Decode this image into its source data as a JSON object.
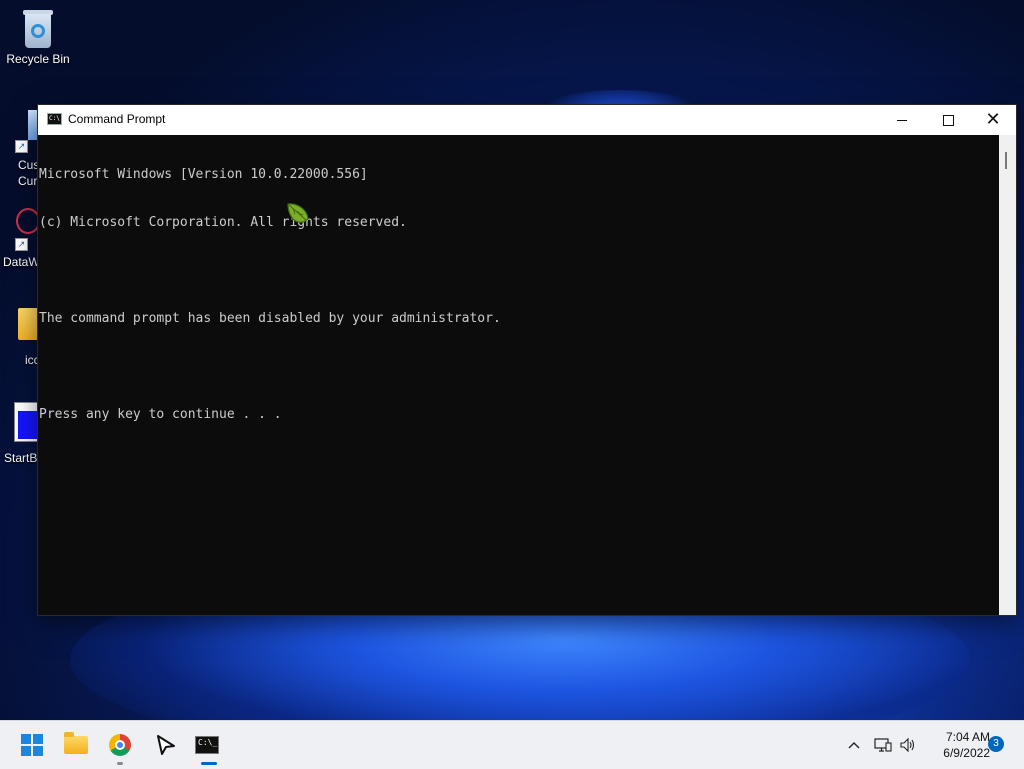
{
  "desktop": {
    "icons": [
      {
        "label": "Recycle Bin"
      },
      {
        "label_visible": "Cus\nCur"
      },
      {
        "label_visible": "DataW"
      },
      {
        "label_visible": "icc"
      },
      {
        "label_visible": "StartBl"
      }
    ]
  },
  "window": {
    "title": "Command Prompt",
    "console_lines": [
      "Microsoft Windows [Version 10.0.22000.556]",
      "(c) Microsoft Corporation. All rights reserved.",
      "",
      "The command prompt has been disabled by your administrator.",
      "",
      "Press any key to continue . . ."
    ],
    "buttons": {
      "minimize": "minimize",
      "maximize": "maximize",
      "close": "close"
    }
  },
  "taskbar": {
    "apps": [
      {
        "name": "Start",
        "icon": "windows-logo-icon"
      },
      {
        "name": "File Explorer",
        "icon": "folder-icon"
      },
      {
        "name": "Google Chrome",
        "icon": "chrome-icon"
      },
      {
        "name": "Pointer app",
        "icon": "pointer-arrow-icon"
      },
      {
        "name": "Command Prompt",
        "icon": "cmd-icon",
        "active": true
      }
    ],
    "tray": {
      "time": "7:04 AM",
      "date": "6/9/2022",
      "notification_count": "3"
    }
  },
  "colors": {
    "console_bg": "#0c0c0c",
    "console_fg": "#cccccc",
    "accent": "#0067c0"
  }
}
